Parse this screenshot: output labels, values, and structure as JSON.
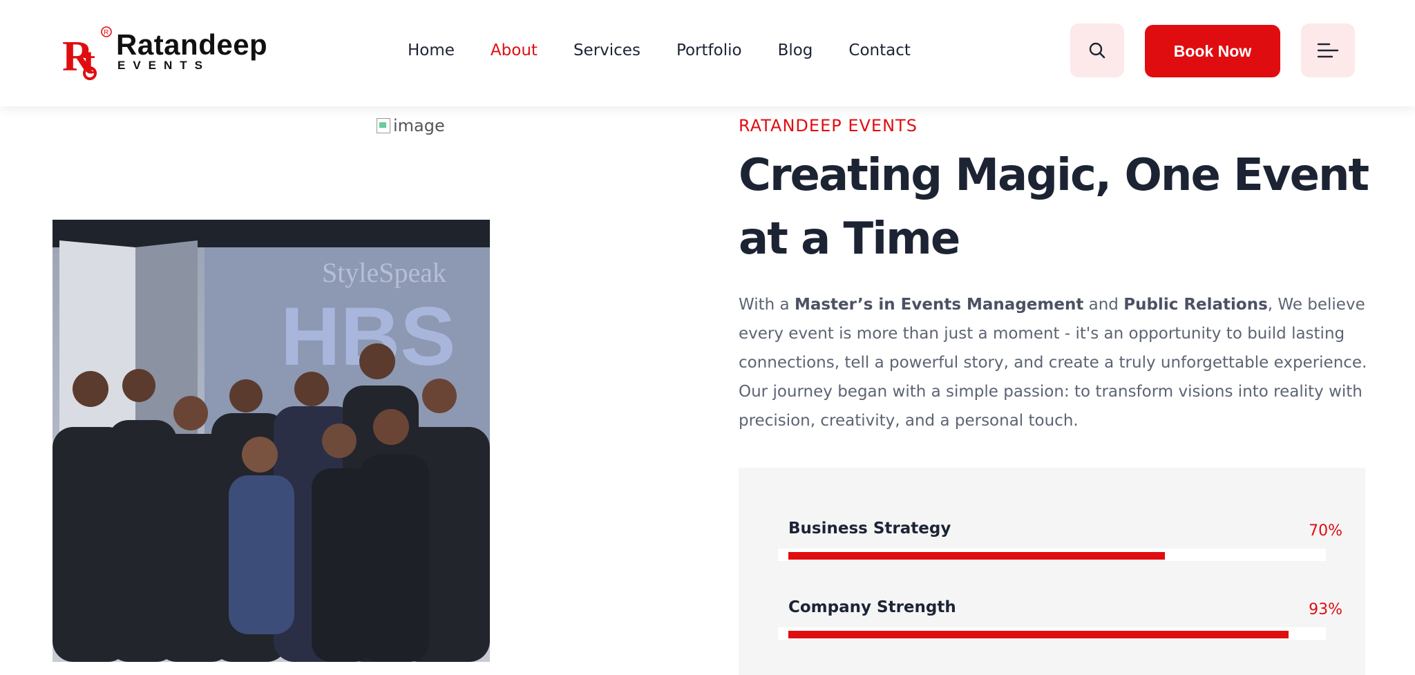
{
  "brand": {
    "name": "Ratandeep",
    "sub": "EVENTS",
    "mark_letters": "Rt",
    "registered": "®",
    "color": "#e00d10"
  },
  "nav": {
    "items": [
      {
        "label": "Home",
        "active": false
      },
      {
        "label": "About",
        "active": true
      },
      {
        "label": "Services",
        "active": false
      },
      {
        "label": "Portfolio",
        "active": false
      },
      {
        "label": "Blog",
        "active": false
      },
      {
        "label": "Contact",
        "active": false
      }
    ]
  },
  "header": {
    "book_label": "Book Now",
    "search_icon": "search-icon",
    "menu_icon": "menu-icon"
  },
  "media": {
    "broken_image_alt": "image",
    "photo_banner": "StyleSpeak",
    "photo_backdrop": "HBS"
  },
  "about": {
    "eyebrow": "RATANDEEP EVENTS",
    "title": "Creating Magic, One Event at a Time",
    "desc": {
      "p1": "With a ",
      "b1": "Master’s in Events Management",
      "p2": " and ",
      "b2": "Public Relations",
      "p3": ", We believe every event is more than just a moment - it's an opportunity to build lasting connections, tell a powerful story, and create a truly unforgettable experience. Our journey began with a simple passion: to transform visions into reality with precision, creativity, and a personal touch."
    }
  },
  "skills": [
    {
      "label": "Business Strategy",
      "value_text": "70%",
      "value": 70
    },
    {
      "label": "Company Strength",
      "value_text": "93%",
      "value": 93
    }
  ],
  "colors": {
    "accent": "#e00d10",
    "heading": "#1c2434",
    "body_text": "#5c6473",
    "soft_accent_bg": "#fde9ea",
    "card_bg": "#f5f5f6"
  }
}
